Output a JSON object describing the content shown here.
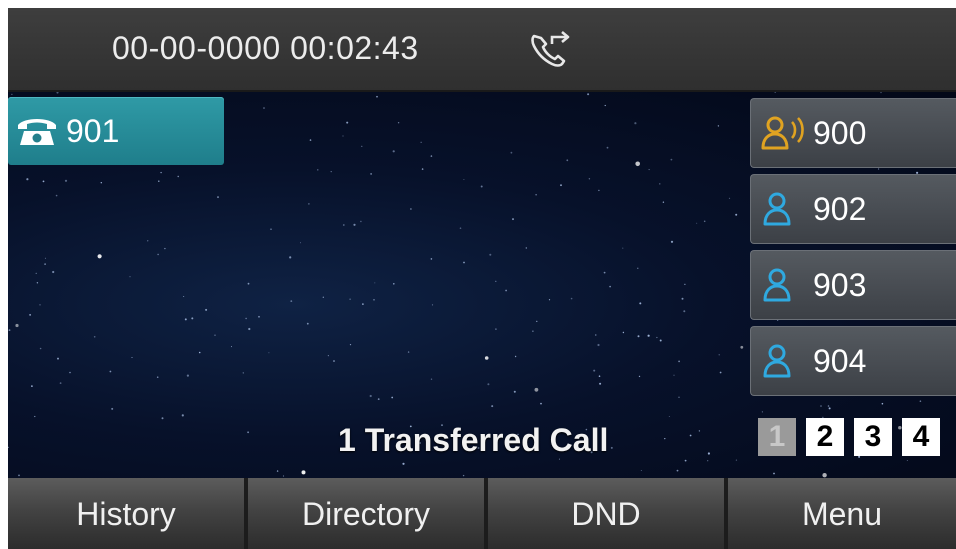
{
  "status_bar": {
    "datetime": "00-00-0000 00:02:43",
    "status_icon": "call-transfer-icon"
  },
  "account": {
    "label": "901",
    "icon": "desk-phone-icon",
    "color": "#2a8f9b"
  },
  "line_keys": [
    {
      "label": "900",
      "icon": "contact-talking-icon",
      "icon_color": "#e0a321"
    },
    {
      "label": "902",
      "icon": "contact-icon",
      "icon_color": "#2fa9e0"
    },
    {
      "label": "903",
      "icon": "contact-icon",
      "icon_color": "#2fa9e0"
    },
    {
      "label": "904",
      "icon": "contact-icon",
      "icon_color": "#2fa9e0"
    }
  ],
  "status_message": "1 Transferred Call",
  "pages": {
    "labels": [
      "1",
      "2",
      "3",
      "4"
    ],
    "current": "1"
  },
  "softkeys": [
    "History",
    "Directory",
    "DND",
    "Menu"
  ]
}
